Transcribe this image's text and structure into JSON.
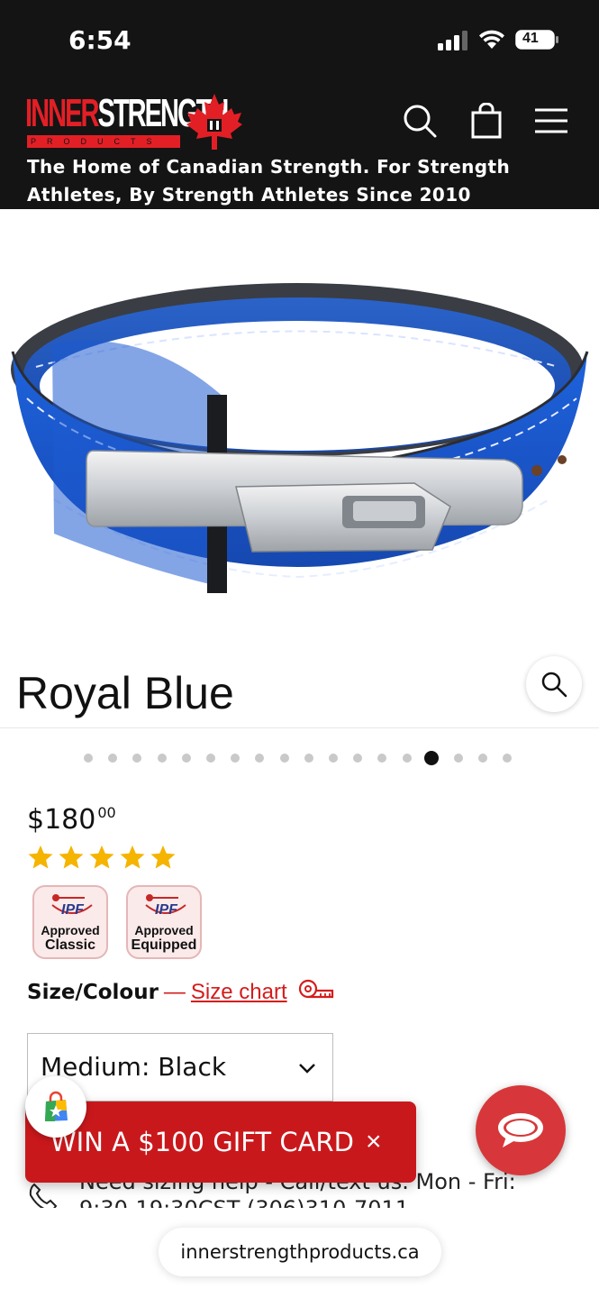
{
  "status_bar": {
    "time": "6:54",
    "battery": "41"
  },
  "header": {
    "logo_text_red": "INNER",
    "logo_text_white": "STRENGTH",
    "logo_subtext": "PRODUCTS",
    "tagline_line1": "The Home of Canadian Strength. For Strength",
    "tagline_line2": "Athletes, By Strength Athletes Since 2010",
    "icons": [
      "search-icon",
      "cart-icon",
      "menu-icon"
    ]
  },
  "product": {
    "image_caption": "Royal Blue",
    "gallery": {
      "total": 18,
      "active_index": 14
    },
    "price_main": "$180",
    "price_cents": "00",
    "rating": 5,
    "badges": [
      {
        "line1": "Approved",
        "line2": "Classic"
      },
      {
        "line1": "Approved",
        "line2": "Equipped"
      }
    ],
    "size_label": "Size/Colour",
    "size_dash": "—",
    "size_chart_label": "Size chart",
    "selected_variant": "Medium: Black",
    "help_line1": "Need sizing help - Call/text us. Mon - Fri:",
    "help_line2": "9:30-19:30CST (306)310-7011"
  },
  "popup": {
    "gift_text": "WIN A $100 GIFT CARD",
    "close": "×"
  },
  "browser": {
    "url": "innerstrengthproducts.ca"
  },
  "colors": {
    "brand_red": "#e31f26",
    "header_bg": "#141414",
    "belt_blue": "#1c5fd6",
    "star_gold": "#f5b400",
    "banner_red": "#c9181c",
    "chat_red": "#d7373a"
  }
}
